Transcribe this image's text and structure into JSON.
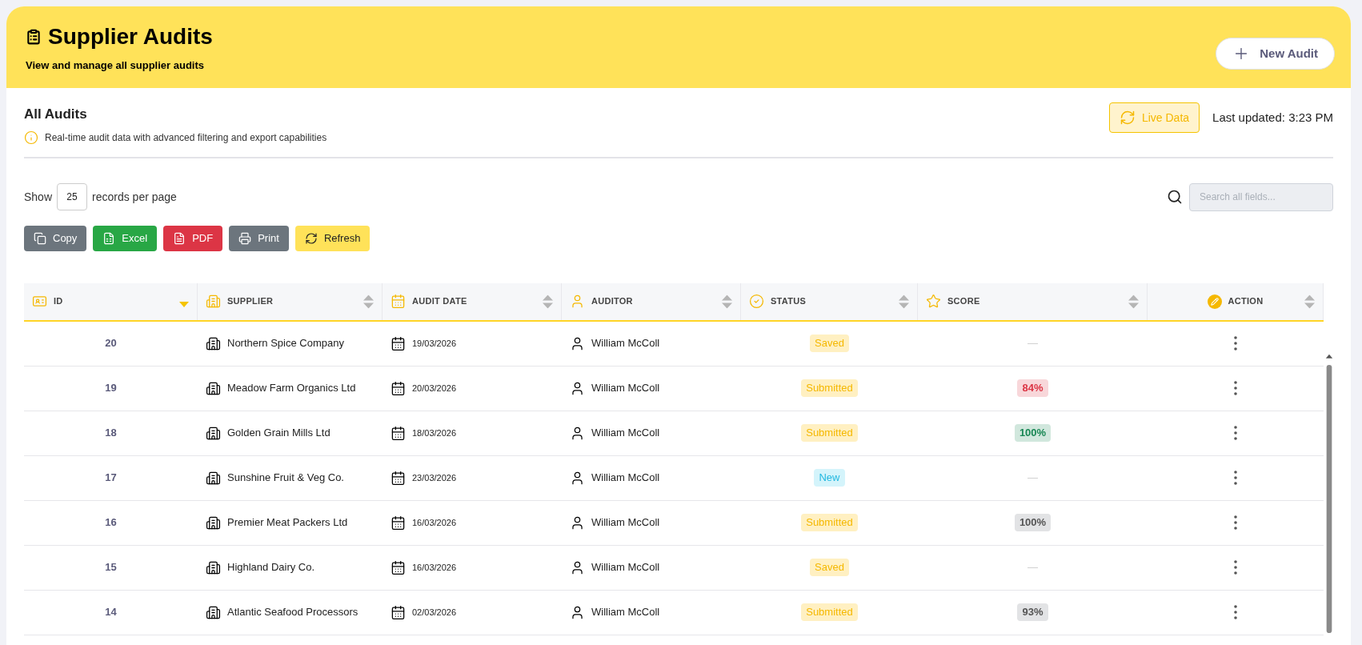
{
  "header": {
    "title": "Supplier Audits",
    "subtitle": "View and manage all supplier audits",
    "new_button": "New Audit"
  },
  "panel": {
    "title": "All Audits",
    "info": "Real-time audit data with advanced filtering and export capabilities",
    "live_badge": "Live Data",
    "last_updated": "Last updated: 3:23 PM"
  },
  "length_control": {
    "show": "Show",
    "value": "25",
    "suffix": "records per page"
  },
  "search": {
    "placeholder": "Search all fields..."
  },
  "toolbar": [
    {
      "label": "Copy",
      "kind": "copy"
    },
    {
      "label": "Excel",
      "kind": "excel"
    },
    {
      "label": "PDF",
      "kind": "pdf"
    },
    {
      "label": "Print",
      "kind": "print"
    },
    {
      "label": "Refresh",
      "kind": "refresh"
    }
  ],
  "table": {
    "columns": [
      {
        "label": "ID",
        "kind": "id",
        "sorted": true
      },
      {
        "label": "SUPPLIER",
        "kind": "supplier",
        "sorted": false
      },
      {
        "label": "AUDIT DATE",
        "kind": "date",
        "sorted": false
      },
      {
        "label": "AUDITOR",
        "kind": "auditor",
        "sorted": false
      },
      {
        "label": "STATUS",
        "kind": "status",
        "sorted": false
      },
      {
        "label": "SCORE",
        "kind": "score",
        "sorted": false
      },
      {
        "label": "ACTION",
        "kind": "action",
        "sorted": false
      }
    ],
    "rows": [
      {
        "id": "20",
        "supplier": "Northern Spice Company",
        "date": "19/03/2026",
        "auditor": "William McColl",
        "status": {
          "label": "Saved",
          "kind": "saved"
        },
        "score": {
          "text": "—",
          "kind": "empty"
        }
      },
      {
        "id": "19",
        "supplier": "Meadow Farm Organics Ltd",
        "date": "20/03/2026",
        "auditor": "William McColl",
        "status": {
          "label": "Submitted",
          "kind": "submitted"
        },
        "score": {
          "text": "84%",
          "kind": "danger"
        }
      },
      {
        "id": "18",
        "supplier": "Golden Grain Mills Ltd",
        "date": "18/03/2026",
        "auditor": "William McColl",
        "status": {
          "label": "Submitted",
          "kind": "submitted"
        },
        "score": {
          "text": "100%",
          "kind": "success"
        }
      },
      {
        "id": "17",
        "supplier": "Sunshine Fruit & Veg Co.",
        "date": "23/03/2026",
        "auditor": "William McColl",
        "status": {
          "label": "New",
          "kind": "new"
        },
        "score": {
          "text": "—",
          "kind": "empty"
        }
      },
      {
        "id": "16",
        "supplier": "Premier Meat Packers Ltd",
        "date": "16/03/2026",
        "auditor": "William McColl",
        "status": {
          "label": "Submitted",
          "kind": "submitted"
        },
        "score": {
          "text": "100%",
          "kind": "neutral"
        }
      },
      {
        "id": "15",
        "supplier": "Highland Dairy Co.",
        "date": "16/03/2026",
        "auditor": "William McColl",
        "status": {
          "label": "Saved",
          "kind": "saved"
        },
        "score": {
          "text": "—",
          "kind": "empty"
        }
      },
      {
        "id": "14",
        "supplier": "Atlantic Seafood Processors",
        "date": "02/03/2026",
        "auditor": "William McColl",
        "status": {
          "label": "Submitted",
          "kind": "submitted"
        },
        "score": {
          "text": "93%",
          "kind": "neutral"
        }
      }
    ]
  }
}
